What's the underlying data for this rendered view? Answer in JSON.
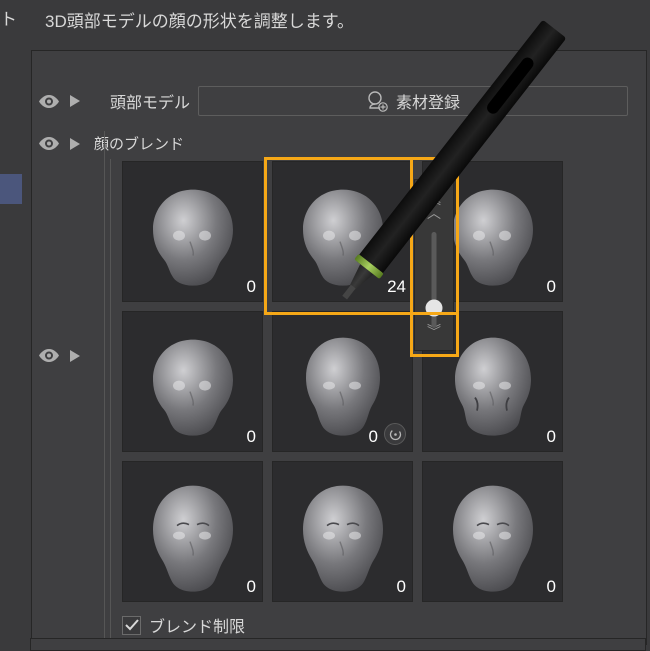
{
  "description": "3D頭部モデルの顔の形状を調整します。",
  "truncated_label": "ト",
  "header": {
    "model_label": "頭部モデル",
    "register_label": "素材登録"
  },
  "section": {
    "face_blend_label": "顔のブレンド"
  },
  "cells": [
    {
      "v": "0"
    },
    {
      "v": "24"
    },
    {
      "v": "0"
    },
    {
      "v": "0"
    },
    {
      "v": "0",
      "timer": true
    },
    {
      "v": "0"
    },
    {
      "v": "0"
    },
    {
      "v": "0"
    },
    {
      "v": "0"
    }
  ],
  "blend_limit_label": "ブレンド制限",
  "blend_limit_checked": true,
  "slider": {
    "value": 24
  }
}
